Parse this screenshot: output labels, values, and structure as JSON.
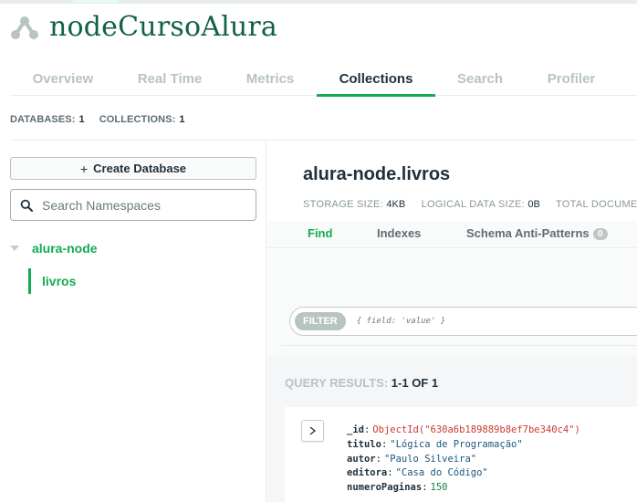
{
  "cluster": {
    "name": "nodeCursoAlura",
    "logo_icon": "cluster-icon",
    "accent": "#116149"
  },
  "tabs": [
    {
      "label": "Overview"
    },
    {
      "label": "Real Time"
    },
    {
      "label": "Metrics"
    },
    {
      "label": "Collections",
      "active": true
    },
    {
      "label": "Search"
    },
    {
      "label": "Profiler"
    }
  ],
  "stats": {
    "databases_label": "DATABASES:",
    "databases_value": "1",
    "collections_label": "COLLECTIONS:",
    "collections_value": "1"
  },
  "sidebar": {
    "create_db_label": "Create Database",
    "search_placeholder": "Search Namespaces",
    "database": {
      "name": "alura-node",
      "collections": [
        {
          "name": "livros"
        }
      ]
    }
  },
  "main": {
    "namespace": "alura-node.livros",
    "storage_size_label": "STORAGE SIZE:",
    "storage_size_value": "4KB",
    "logical_size_label": "LOGICAL DATA SIZE:",
    "logical_size_value": "0B",
    "total_docs_label": "TOTAL DOCUMENTS:",
    "subtabs": {
      "find": "Find",
      "indexes": "Indexes",
      "schema": "Schema Anti-Patterns",
      "schema_count": "0"
    },
    "filter": {
      "label": "FILTER",
      "placeholder": "{ field: 'value' }"
    },
    "results": {
      "label": "QUERY RESULTS:",
      "count": "1-1 OF 1"
    },
    "document": {
      "id_key": "_id",
      "id_value": "ObjectId(\"630a6b189889b8ef7be340c4\")",
      "titulo_key": "titulo",
      "titulo_value": "\"Lógica de Programação\"",
      "autor_key": "autor",
      "autor_value": "\"Paulo Silveira\"",
      "editora_key": "editora",
      "editora_value": "\"Casa do Código\"",
      "paginas_key": "numeroPaginas",
      "paginas_value": "150"
    }
  },
  "colors": {
    "accent_green": "#13aa52",
    "text_dark": "#21313c",
    "muted": "#b8c4c2"
  }
}
